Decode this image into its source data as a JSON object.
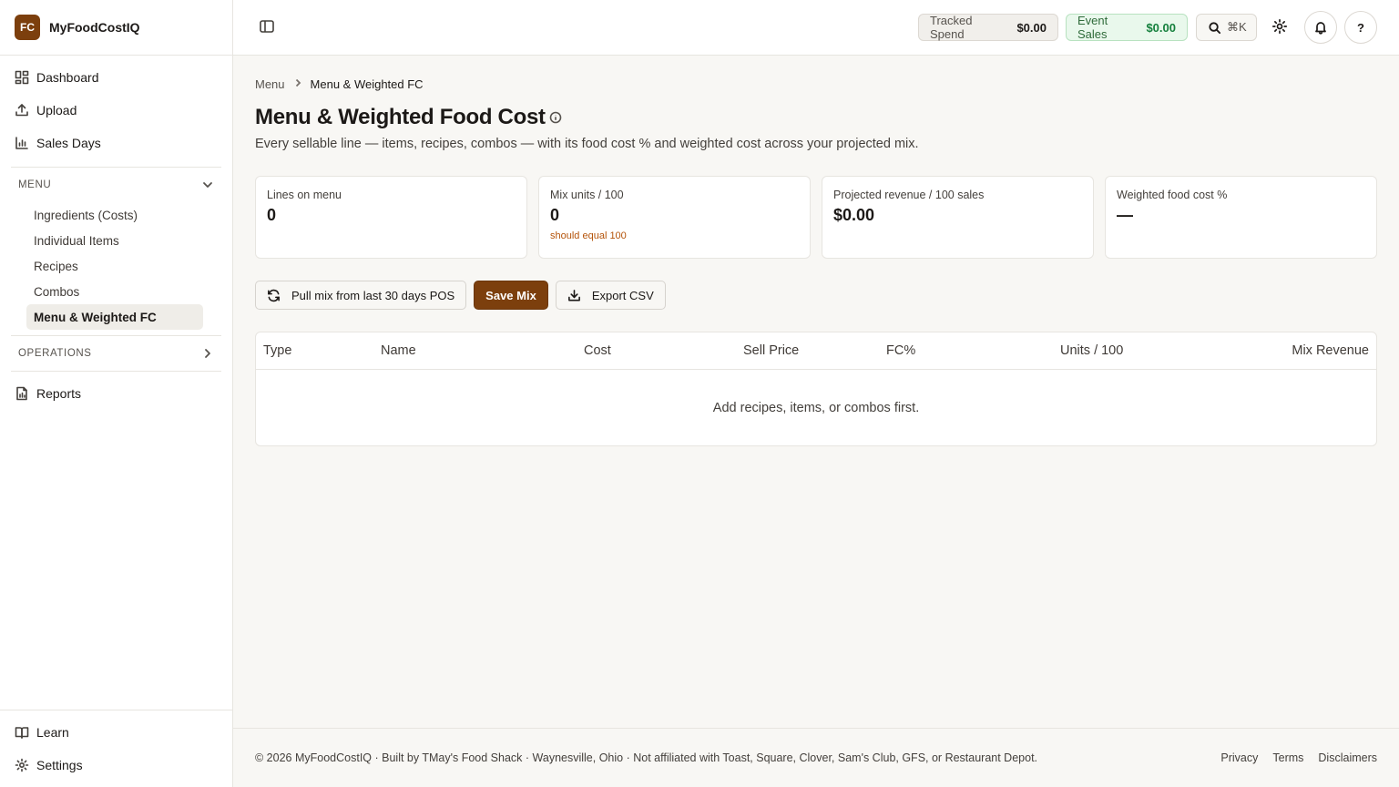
{
  "brand": {
    "logo_text": "FC",
    "name": "MyFoodCostIQ",
    "accent_color": "#7c3f0d"
  },
  "sidebar": {
    "top_items": [
      {
        "label": "Dashboard",
        "icon": "dashboard-icon"
      },
      {
        "label": "Upload",
        "icon": "upload-icon"
      },
      {
        "label": "Sales Days",
        "icon": "bar-chart-icon"
      }
    ],
    "menu_section": {
      "title": "MENU",
      "expanded": true,
      "items": [
        {
          "label": "Ingredients (Costs)"
        },
        {
          "label": "Individual Items"
        },
        {
          "label": "Recipes"
        },
        {
          "label": "Combos"
        },
        {
          "label": "Menu & Weighted FC",
          "active": true
        }
      ]
    },
    "operations_section": {
      "title": "OPERATIONS",
      "expanded": false
    },
    "reports": {
      "label": "Reports",
      "icon": "report-icon"
    },
    "bottom_items": [
      {
        "label": "Learn",
        "icon": "book-icon"
      },
      {
        "label": "Settings",
        "icon": "gear-icon"
      }
    ]
  },
  "topbar": {
    "tracked_spend": {
      "label": "Tracked Spend",
      "value": "$0.00"
    },
    "event_sales": {
      "label": "Event Sales",
      "value": "$0.00"
    },
    "search_shortcut": "⌘K",
    "help_label": "?"
  },
  "breadcrumb": {
    "parent": "Menu",
    "current": "Menu & Weighted FC"
  },
  "page": {
    "title": "Menu & Weighted Food Cost",
    "description": "Every sellable line — items, recipes, combos — with its food cost % and weighted cost across your projected mix."
  },
  "stats": [
    {
      "label": "Lines on menu",
      "value": "0",
      "note": ""
    },
    {
      "label": "Mix units / 100",
      "value": "0",
      "note": "should equal 100"
    },
    {
      "label": "Projected revenue / 100 sales",
      "value": "$0.00",
      "note": ""
    },
    {
      "label": "Weighted food cost %",
      "value": "—",
      "note": ""
    }
  ],
  "actions": {
    "pull_mix": "Pull mix from last 30 days POS",
    "save_mix": "Save Mix",
    "export_csv": "Export CSV"
  },
  "table": {
    "columns": [
      "Type",
      "Name",
      "Cost",
      "Sell Price",
      "FC%",
      "Units / 100",
      "Mix Revenue"
    ],
    "rows": [],
    "empty_message": "Add recipes, items, or combos first."
  },
  "footer": {
    "copyright": "© 2026 MyFoodCostIQ · Built by TMay's Food Shack · Waynesville, Ohio · Not affiliated with Toast, Square, Clover, Sam's Club, GFS, or Restaurant Depot.",
    "links": [
      "Privacy",
      "Terms",
      "Disclaimers"
    ]
  }
}
